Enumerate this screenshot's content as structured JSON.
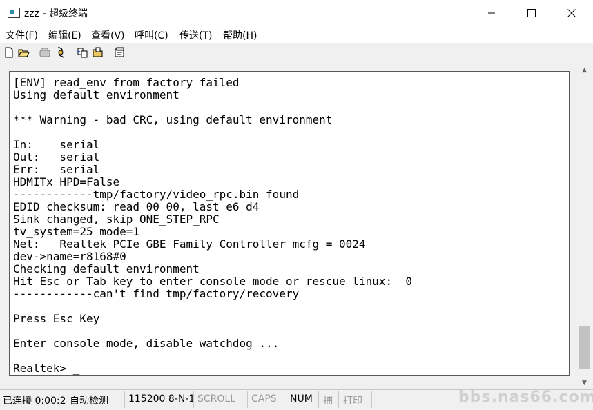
{
  "window": {
    "title": "zzz - 超级终端",
    "minimize_label": "—",
    "maximize_label": "☐",
    "close_label": "✕"
  },
  "menu": {
    "items": [
      "文件(F)",
      "编辑(E)",
      "查看(V)",
      "呼叫(C)",
      "传送(T)",
      "帮助(H)"
    ]
  },
  "toolbar": {
    "buttons": [
      "new-icon",
      "open-icon",
      "call-icon",
      "disconnect-icon",
      "send-icon",
      "receive-icon",
      "properties-icon"
    ]
  },
  "terminal": {
    "lines": [
      "[ENV] read_env from factory failed",
      "Using default environment",
      "",
      "*** Warning - bad CRC, using default environment",
      "",
      "In:    serial",
      "Out:   serial",
      "Err:   serial",
      "HDMITx_HPD=False",
      "------------tmp/factory/video_rpc.bin found",
      "EDID checksum: read 00 00, last e6 d4",
      "Sink changed, skip ONE_STEP_RPC",
      "tv_system=25 mode=1",
      "Net:   Realtek PCIe GBE Family Controller mcfg = 0024",
      "dev->name=r8168#0",
      "Checking default environment",
      "Hit Esc or Tab key to enter console mode or rescue linux:  0",
      "------------can't find tmp/factory/recovery",
      "",
      "Press Esc Key",
      "",
      "Enter console mode, disable watchdog ...",
      "",
      "Realtek> _"
    ]
  },
  "status": {
    "connection": "已连接 0:00:2",
    "detect": "自动检测",
    "port": "115200 8-N-1",
    "scroll": "SCROLL",
    "caps": "CAPS",
    "num": "NUM",
    "capture": "捕",
    "print": "打印"
  },
  "watermark": "bbs.nas66.com"
}
